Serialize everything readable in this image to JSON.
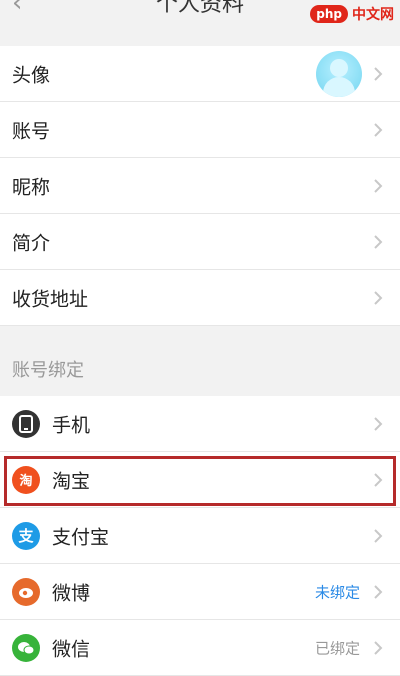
{
  "header": {
    "title": "个人资料",
    "watermark_php": "php",
    "watermark_site": "中文网"
  },
  "profile": {
    "items": [
      {
        "label": "头像"
      },
      {
        "label": "账号"
      },
      {
        "label": "昵称"
      },
      {
        "label": "简介"
      },
      {
        "label": "收货地址"
      }
    ]
  },
  "bindings": {
    "section_title": "账号绑定",
    "items": [
      {
        "label": "手机",
        "icon": "phone-icon",
        "status": ""
      },
      {
        "label": "淘宝",
        "icon": "taobao-icon",
        "status": ""
      },
      {
        "label": "支付宝",
        "icon": "alipay-icon",
        "status": ""
      },
      {
        "label": "微博",
        "icon": "weibo-icon",
        "status": "未绑定"
      },
      {
        "label": "微信",
        "icon": "wechat-icon",
        "status": "已绑定"
      }
    ]
  },
  "colors": {
    "unbound": "#2a8ae6",
    "bound": "#999999",
    "taobao": "#f0501e",
    "alipay": "#1e9be6",
    "weibo": "#e66a2c",
    "wechat": "#37b33a",
    "phone": "#333333",
    "highlight_border": "#b52a2a"
  }
}
